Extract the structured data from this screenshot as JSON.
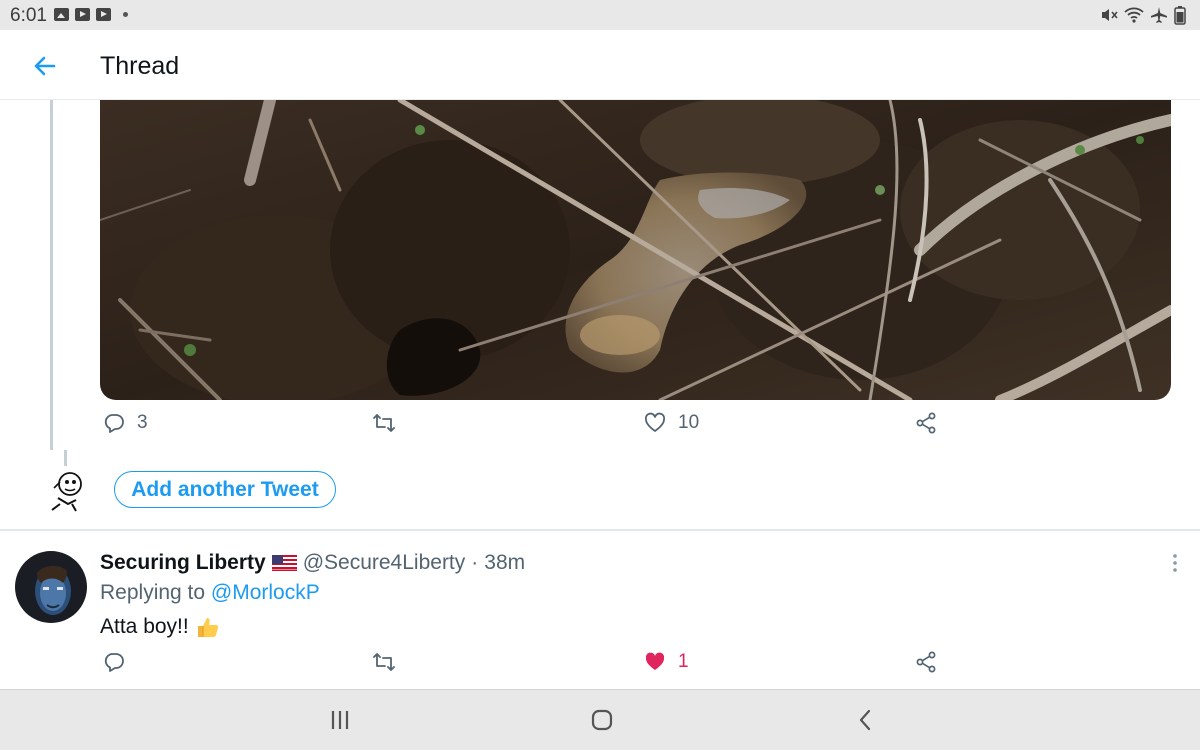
{
  "status_bar": {
    "time": "6:01",
    "left_icons": [
      "gallery-icon",
      "youtube-icon",
      "youtube-icon",
      "dot-icon"
    ],
    "right_icons": [
      "mute-icon",
      "wifi-icon",
      "airplane-icon",
      "battery-icon"
    ]
  },
  "header": {
    "title": "Thread",
    "back_icon": "arrow-left-icon"
  },
  "thread_tweet": {
    "media_icon": "photo-image",
    "actions": {
      "reply_count": "3",
      "retweet_count": "",
      "like_count": "10",
      "share_icon": "share-icon"
    }
  },
  "compose": {
    "add_tweet_label": "Add another Tweet"
  },
  "reply_tweet": {
    "name": "Securing Liberty",
    "flag_icon": "us-flag-icon",
    "handle": "@Secure4Liberty",
    "separator": "·",
    "time": "38m",
    "replying_prefix": "Replying to",
    "replying_to": "@MorlockP",
    "text": "Atta boy!!",
    "emoji_icon": "thumbs-up-icon",
    "actions": {
      "reply_count": "",
      "retweet_count": "",
      "like_count": "1",
      "liked": true
    }
  },
  "colors": {
    "accent": "#1d9bf0",
    "like": "#e0245e",
    "muted_text": "#536471",
    "status_bar_bg": "#e8e8e8"
  }
}
